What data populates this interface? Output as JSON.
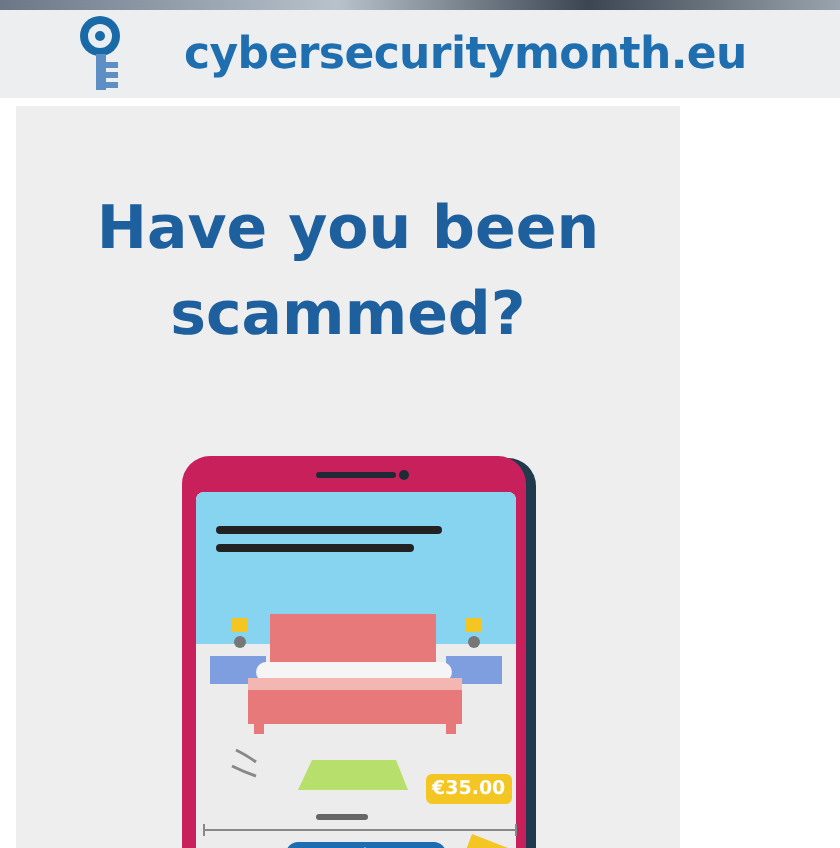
{
  "site": {
    "domain": "cybersecuritymonth.eu"
  },
  "headline": "Have you been scammed?",
  "listing": {
    "price": "€35.00"
  }
}
